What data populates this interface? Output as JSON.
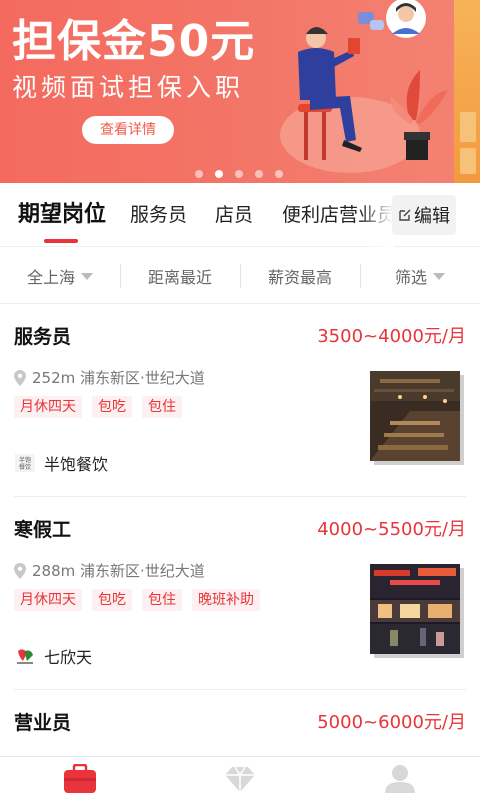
{
  "banner": {
    "title": "担保金50元",
    "subtitle": "视频面试担保入职",
    "button_label": "查看详情",
    "page_count": 5,
    "active_page": 2
  },
  "tabs": {
    "items": [
      "期望岗位",
      "服务员",
      "店员",
      "便利店营业员"
    ],
    "active_index": 0,
    "edit_label": "编辑"
  },
  "filters": [
    {
      "label": "全上海",
      "has_caret": true
    },
    {
      "label": "距离最近",
      "has_caret": false
    },
    {
      "label": "薪资最高",
      "has_caret": false
    },
    {
      "label": "筛选",
      "has_caret": true
    }
  ],
  "jobs": [
    {
      "title": "服务员",
      "salary": "3500~4000元/月",
      "location": "252m 浦东新区·世纪大道",
      "tags": [
        "月休四天",
        "包吃",
        "包住"
      ],
      "company": "半饱餐饮",
      "company_logo_text": "半饱餐饮",
      "thumb": "restaurant-interior-photo"
    },
    {
      "title": "寒假工",
      "salary": "4000~5500元/月",
      "location": "288m 浦东新区·世纪大道",
      "tags": [
        "月休四天",
        "包吃",
        "包住",
        "晚班补助"
      ],
      "company": "七欣天",
      "thumb": "storefront-night-photo"
    },
    {
      "title": "营业员",
      "salary": "5000~6000元/月"
    }
  ],
  "bottom_nav": [
    {
      "icon": "briefcase-icon",
      "active": true
    },
    {
      "icon": "diamond-icon",
      "active": false
    },
    {
      "icon": "profile-icon",
      "active": false
    }
  ],
  "colors": {
    "accent": "#e8343a",
    "banner_bg": "#f46a5e",
    "tag_bg": "#fdf0f0"
  }
}
